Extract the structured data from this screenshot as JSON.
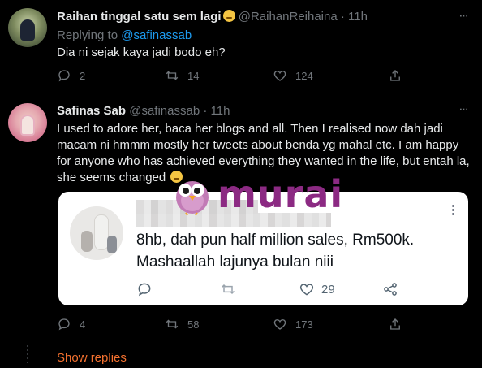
{
  "colors": {
    "background": "#000000",
    "text": "#e7e9ea",
    "secondary": "#71767b",
    "link": "#1d9bf0",
    "show_replies": "#f4712f",
    "logo": "#8c2a83"
  },
  "reply1": {
    "name": "Raihan tinggal satu sem lagi",
    "name_emoji": "relieved-face-emoji",
    "handle": "@RaihanReihaina",
    "dot": "·",
    "time": "11h",
    "replying_prefix": "Replying to",
    "replying_to": "@safinassab",
    "text": "Dia ni sejak kaya jadi bodo eh?",
    "actions": {
      "replies": "2",
      "retweets": "14",
      "likes": "124"
    }
  },
  "reply2": {
    "name": "Safinas Sab",
    "handle": "@safinassab",
    "dot": "·",
    "time": "11h",
    "text": "I used to adore her, baca her blogs and all. Then I realised now dah jadi macam ni hmmm mostly her tweets about benda yg mahal etc. I am happy for anyone who has achieved everything they wanted in the life, but entah la, she seems changed",
    "text_emoji": "rolling-eyes-emoji",
    "actions": {
      "replies": "4",
      "retweets": "58",
      "likes": "173"
    }
  },
  "embedded": {
    "text": "8hb, dah pun half million sales, Rm500k. Mashaallah lajunya bulan niii",
    "likes": "29"
  },
  "watermark": {
    "text": "murai",
    "icon": "bird-mascot-icon"
  },
  "show_replies": "Show replies"
}
